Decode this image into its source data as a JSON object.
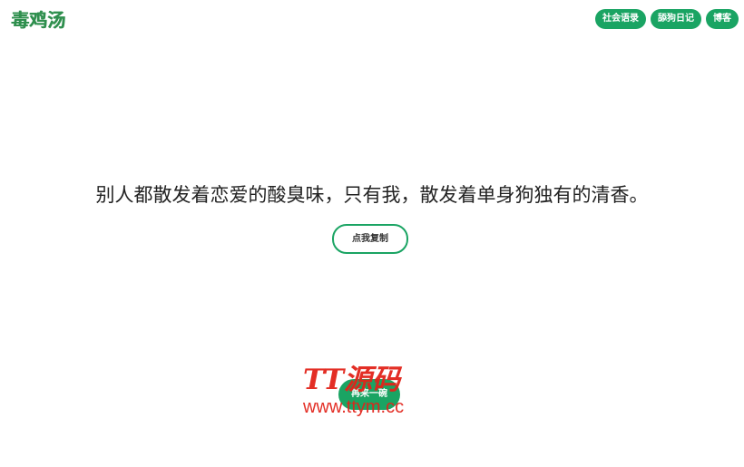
{
  "header": {
    "logo_text": "毒鸡汤",
    "nav": [
      {
        "label": "社会语录"
      },
      {
        "label": "舔狗日记"
      },
      {
        "label": "博客"
      }
    ]
  },
  "main": {
    "quote": "别人都散发着恋爱的酸臭味，只有我，散发着单身狗独有的清香。",
    "copy_button": "点我复制",
    "next_button": "再来一碗"
  },
  "watermark": {
    "line1": "TT源码",
    "line2": "www.ttym.cc"
  },
  "colors": {
    "accent": "#1aa463",
    "logo": "#2f8f4e",
    "watermark": "#e2231a"
  }
}
